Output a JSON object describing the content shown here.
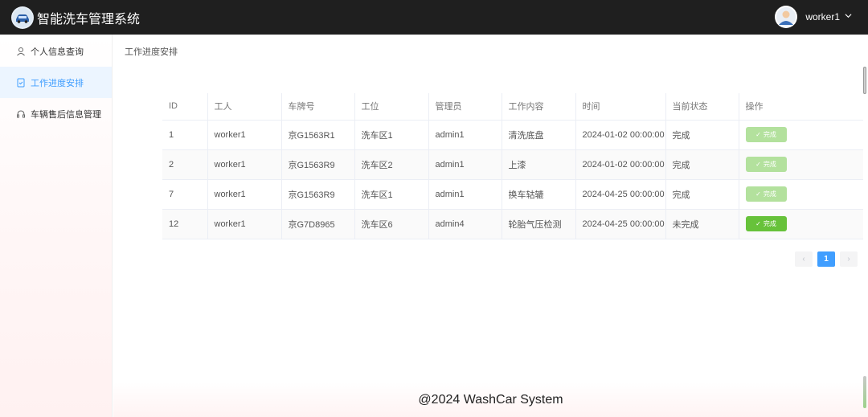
{
  "header": {
    "app_title": "智能洗车管理系统",
    "username": "worker1"
  },
  "sidebar": {
    "items": [
      {
        "label": "个人信息查询"
      },
      {
        "label": "工作进度安排"
      },
      {
        "label": "车辆售后信息管理"
      }
    ]
  },
  "breadcrumb": "工作进度安排",
  "table": {
    "headers": [
      "ID",
      "工人",
      "车牌号",
      "工位",
      "管理员",
      "工作内容",
      "时间",
      "当前状态",
      "操作"
    ],
    "rows": [
      {
        "id": "1",
        "worker": "worker1",
        "plate": "京G1563R1",
        "station": "洗车区1",
        "admin": "admin1",
        "content": "清洗底盘",
        "time": "2024-01-02 00:00:00",
        "status": "完成",
        "action": "完成"
      },
      {
        "id": "2",
        "worker": "worker1",
        "plate": "京G1563R9",
        "station": "洗车区2",
        "admin": "admin1",
        "content": "上漆",
        "time": "2024-01-02 00:00:00",
        "status": "完成",
        "action": "完成"
      },
      {
        "id": "7",
        "worker": "worker1",
        "plate": "京G1563R9",
        "station": "洗车区1",
        "admin": "admin1",
        "content": "换车轱辘",
        "time": "2024-04-25 00:00:00",
        "status": "完成",
        "action": "完成"
      },
      {
        "id": "12",
        "worker": "worker1",
        "plate": "京G7D8965",
        "station": "洗车区6",
        "admin": "admin4",
        "content": "轮胎气压检测",
        "time": "2024-04-25 00:00:00",
        "status": "未完成",
        "action": "完成"
      }
    ]
  },
  "pagination": {
    "prev": "‹",
    "current": "1",
    "next": "›"
  },
  "footer": "@2024 WashCar System",
  "colors": {
    "topbar": "#1f1f1f",
    "accent": "#409eff",
    "done_disabled": "#b3e19d",
    "done_enabled": "#67c23a"
  }
}
